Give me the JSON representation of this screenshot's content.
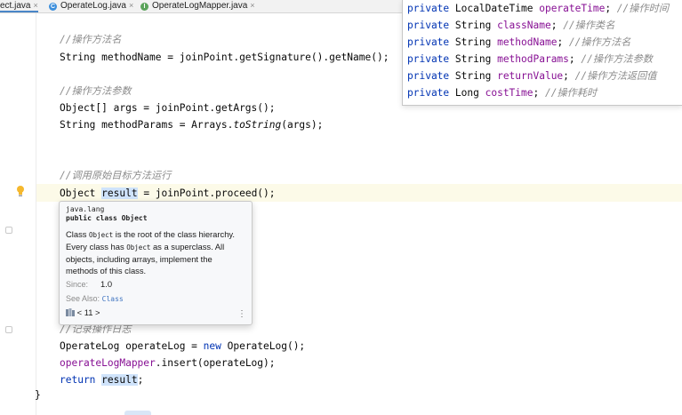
{
  "tabs": [
    {
      "label": "ect.java",
      "icon": "none",
      "active": true
    },
    {
      "label": "OperateLog.java",
      "icon": "C",
      "color": "#3d8fdc"
    },
    {
      "label": "OperateLogMapper.java",
      "icon": "I",
      "color": "#5aa35a"
    }
  ],
  "code": {
    "c1": "//操作方法名",
    "l1a": "String methodName = joinPoint.getSignature().getName();",
    "c2": "//操作方法参数",
    "l2a": "Object[] args = joinPoint.getArgs();",
    "l2b_pre": "String methodParams = Arrays.",
    "l2b_it": "toString",
    "l2b_post": "(args);",
    "c3": "//调用原始目标方法运行",
    "l3_obj": "Object",
    "l3_sel": "result",
    "l3_post": " = joinPoint.proceed();",
    "c4": "//记录操作日志",
    "l4a_pre": "OperateLog operateLog = ",
    "l4a_kw": "new",
    "l4a_post": " OperateLog();",
    "l4b_fld": "operateLogMapper",
    "l4b_post": ".insert(operateLog);",
    "l4c_kw": "return",
    "l4c_val": "result",
    "l4c_post": ";",
    "brace": "}"
  },
  "fields_popup": {
    "kw": "private",
    "rows": [
      {
        "type": "LocalDateTime",
        "name": "operateTime",
        "comment": "//操作时间"
      },
      {
        "type": "String",
        "name": "className",
        "comment": "//操作类名"
      },
      {
        "type": "String",
        "name": "methodName",
        "comment": "//操作方法名"
      },
      {
        "type": "String",
        "name": "methodParams",
        "comment": "//操作方法参数"
      },
      {
        "type": "String",
        "name": "returnValue",
        "comment": "//操作方法返回值"
      },
      {
        "type": "Long",
        "name": "costTime",
        "comment": "//操作耗时"
      }
    ]
  },
  "doc_popup": {
    "package": "java.lang",
    "declaration": "public class Object",
    "p1": "Class ",
    "p1_code": "Object",
    "p1_b": " is the root of the class hierarchy. Every class has ",
    "p1_code2": "Object",
    "p1_c": " as a superclass. All objects, including arrays, implement the methods of this class.",
    "since_label": "Since:",
    "since_value": "1.0",
    "see_label": "See Also:",
    "see_link": "Class",
    "jdk": "< 11 >",
    "more": "⋮"
  }
}
